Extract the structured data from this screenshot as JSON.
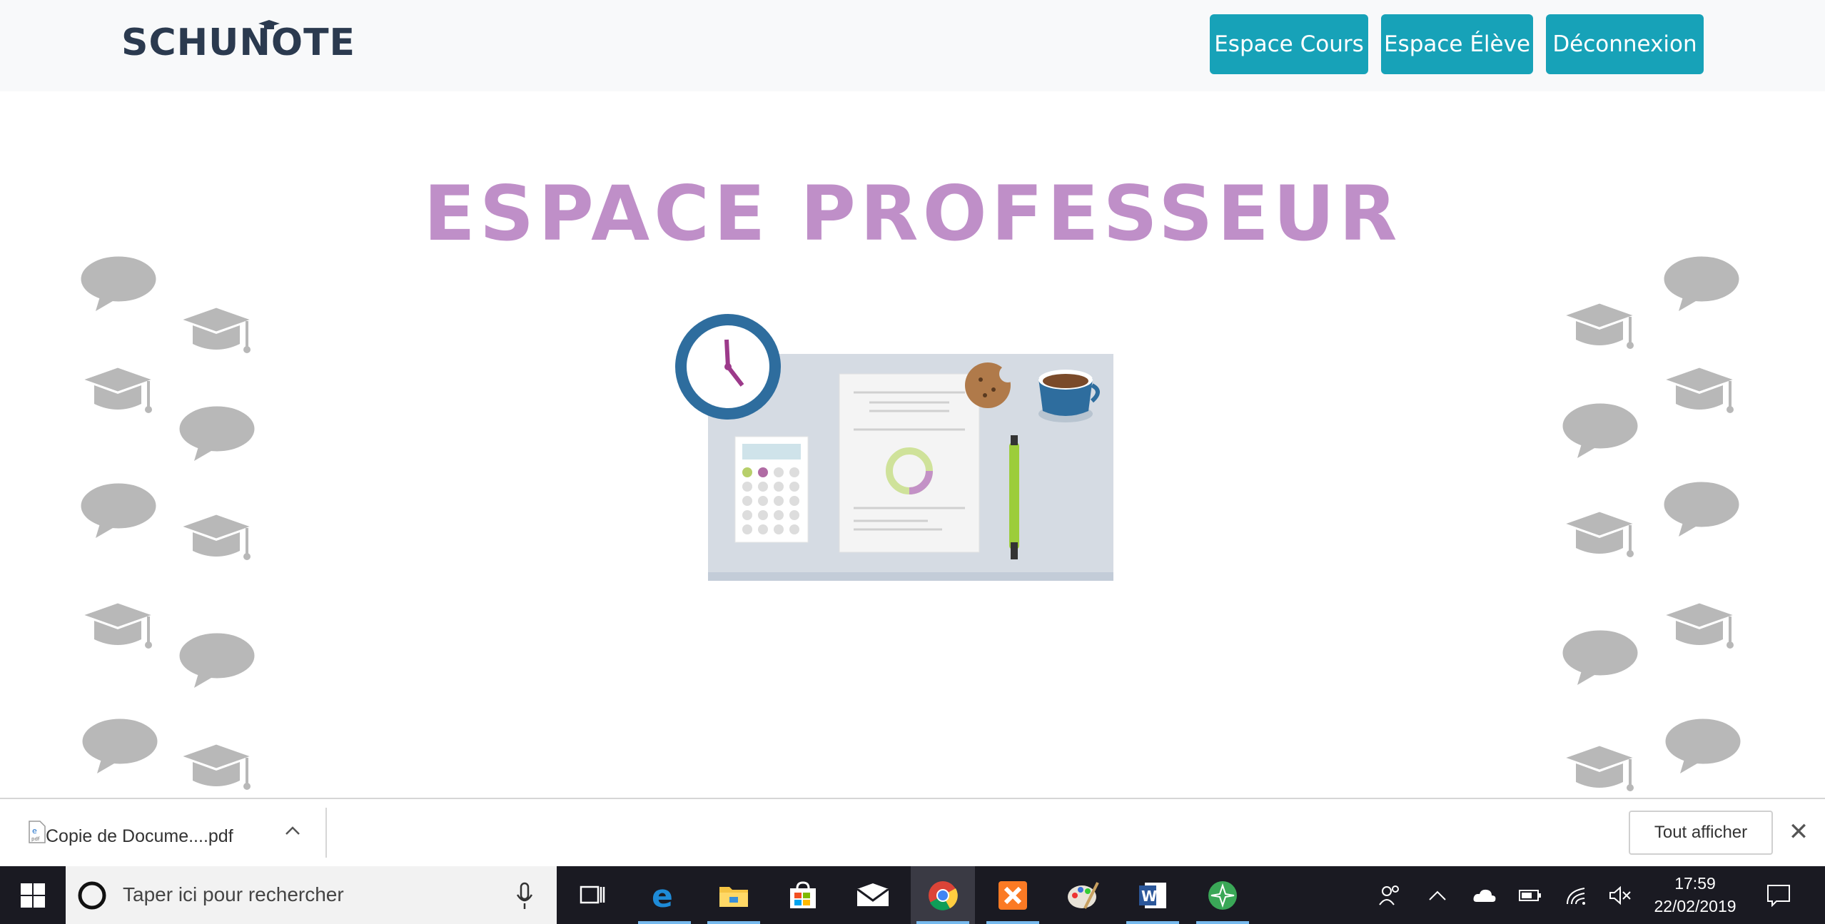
{
  "navbar": {
    "brand": "SCHUNOTE",
    "buttons": [
      "Espace Cours",
      "Espace Élève",
      "Déconnexion"
    ],
    "button_color": "#17a2b8"
  },
  "main": {
    "title": "ESPACE PROFESSEUR",
    "title_color": "#bf8fc8",
    "decor_icons": [
      "speech-bubble-icon",
      "graduation-cap-icon"
    ]
  },
  "download_bar": {
    "file_name": "Copie de Docume....pdf",
    "show_all": "Tout afficher",
    "close": "✕"
  },
  "taskbar": {
    "search_placeholder": "Taper ici pour rechercher",
    "time": "17:59",
    "date": "22/02/2019",
    "apps": [
      "task-view-icon",
      "edge-icon",
      "file-explorer-icon",
      "store-icon",
      "mail-icon",
      "chrome-icon",
      "xampp-icon",
      "paint-icon",
      "word-icon",
      "app-icon"
    ]
  }
}
